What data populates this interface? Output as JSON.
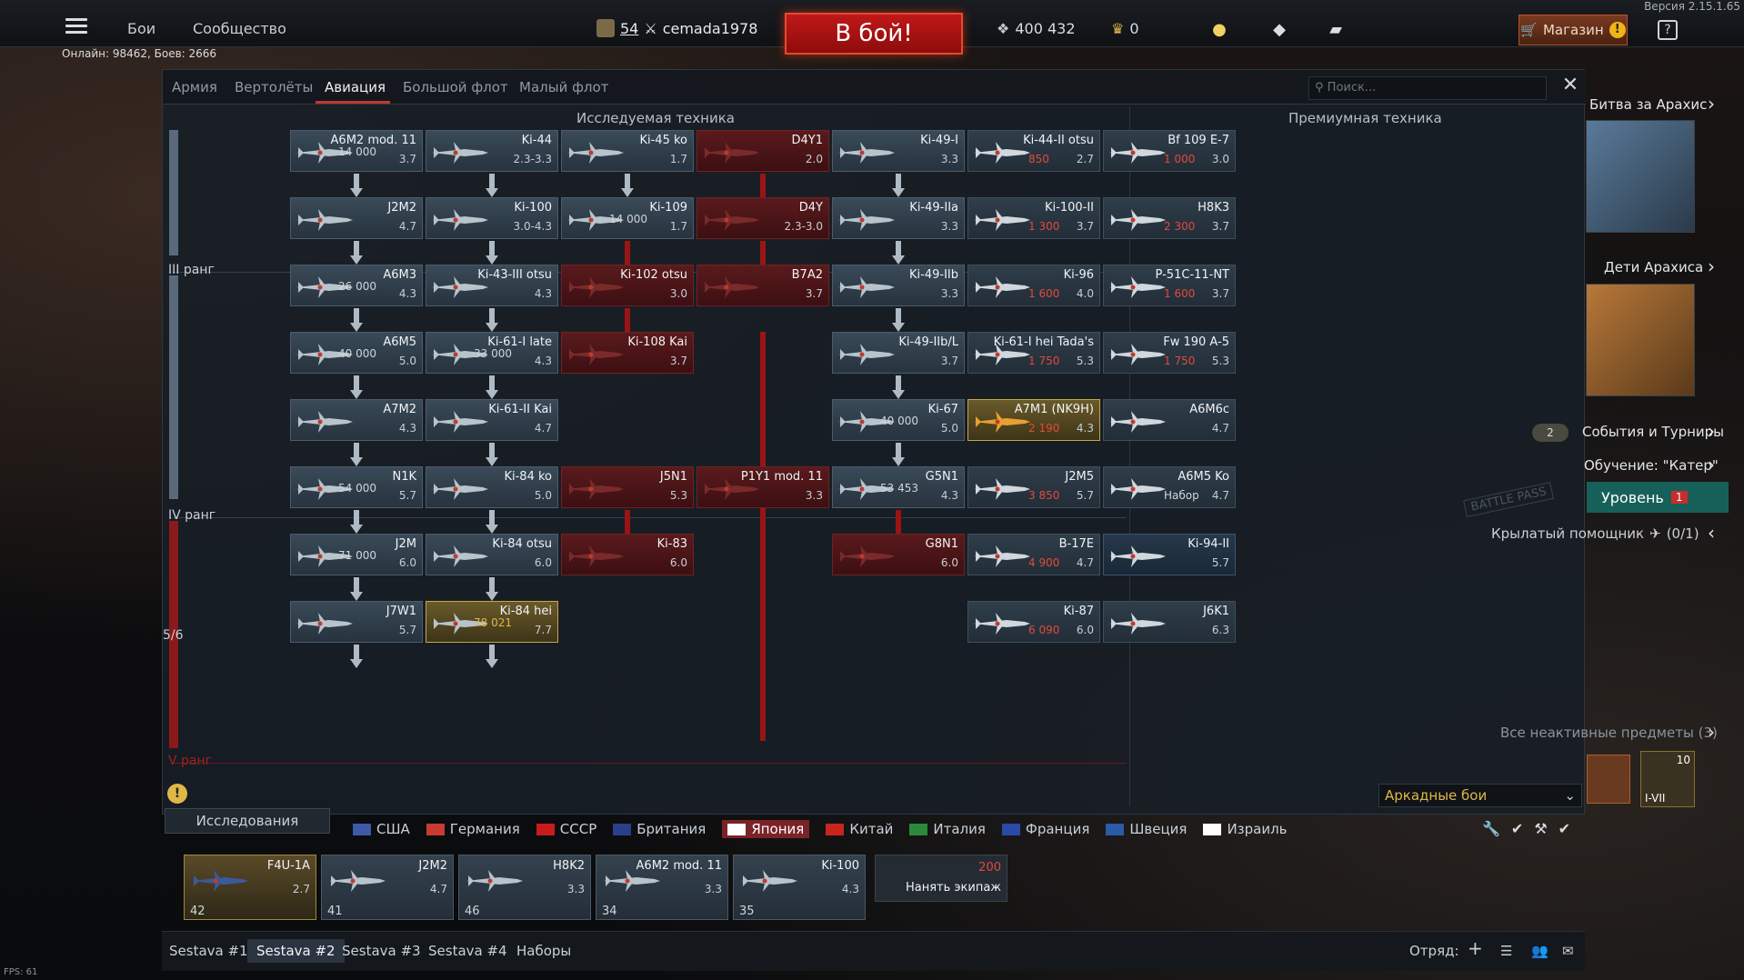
{
  "topbar": {
    "nav": [
      "Бои",
      "Сообщество"
    ],
    "online": "Онлайн: 98462, Боев: 2666",
    "version": "Версия 2.15.1.65",
    "player_level": "54",
    "player_name": "cemada1978",
    "to_battle": "В бой!",
    "silver": "400 432",
    "gold": "0",
    "shop": "Магазин"
  },
  "tabs": [
    "Армия",
    "Вертолёты",
    "Авиация",
    "Большой флот",
    "Малый флот"
  ],
  "active_tab": "Авиация",
  "search_placeholder": "Поиск...",
  "headers": {
    "research": "Исследуемая техника",
    "premium": "Премиумная техника"
  },
  "ranks": {
    "r3": "III ранг",
    "r4": "IV ранг",
    "r5": "V ранг",
    "progress": "5/6"
  },
  "cards": [
    {
      "n": "A6M2 mod. 11",
      "br": "3.7",
      "rp": "14 000",
      "s": "n",
      "c": 0,
      "r": 0
    },
    {
      "n": "Ki-44",
      "br": "2.3-3.3",
      "s": "n",
      "c": 1,
      "r": 0
    },
    {
      "n": "Ki-45 ko",
      "br": "1.7",
      "s": "n",
      "c": 2,
      "r": 0
    },
    {
      "n": "D4Y1",
      "br": "2.0",
      "s": "red",
      "c": 3,
      "r": 0
    },
    {
      "n": "Ki-49-I",
      "br": "3.3",
      "s": "n",
      "c": 4,
      "r": 0
    },
    {
      "n": "J2M2",
      "br": "4.7",
      "s": "n",
      "c": 0,
      "r": 1
    },
    {
      "n": "Ki-100",
      "br": "3.0-4.3",
      "s": "n",
      "c": 1,
      "r": 1
    },
    {
      "n": "Ki-109",
      "br": "1.7",
      "rp": "14 000",
      "s": "n",
      "c": 2,
      "r": 1
    },
    {
      "n": "D4Y",
      "br": "2.3-3.0",
      "s": "red",
      "c": 3,
      "r": 1
    },
    {
      "n": "Ki-49-IIa",
      "br": "3.3",
      "s": "n",
      "c": 4,
      "r": 1
    },
    {
      "n": "A6M3",
      "br": "4.3",
      "rp": "26 000",
      "s": "n",
      "c": 0,
      "r": 2
    },
    {
      "n": "Ki-43-III otsu",
      "br": "4.3",
      "s": "n",
      "c": 1,
      "r": 2
    },
    {
      "n": "Ki-102 otsu",
      "br": "3.0",
      "s": "red",
      "c": 2,
      "r": 2
    },
    {
      "n": "B7A2",
      "br": "3.7",
      "s": "red",
      "c": 3,
      "r": 2
    },
    {
      "n": "Ki-49-IIb",
      "br": "3.3",
      "s": "n",
      "c": 4,
      "r": 2
    },
    {
      "n": "A6M5",
      "br": "5.0",
      "rp": "40 000",
      "s": "n",
      "c": 0,
      "r": 3
    },
    {
      "n": "Ki-61-I late",
      "br": "4.3",
      "rp": "33 000",
      "s": "n",
      "c": 1,
      "r": 3
    },
    {
      "n": "Ki-108 Kai",
      "br": "3.7",
      "s": "red",
      "c": 2,
      "r": 3
    },
    {
      "n": "Ki-49-IIb/L",
      "br": "3.7",
      "s": "n",
      "c": 4,
      "r": 3
    },
    {
      "n": "A7M2",
      "br": "4.3",
      "s": "n",
      "c": 0,
      "r": 4
    },
    {
      "n": "Ki-61-II Kai",
      "br": "4.7",
      "s": "n",
      "c": 1,
      "r": 4
    },
    {
      "n": "Ki-67",
      "br": "5.0",
      "rp": "40 000",
      "s": "n",
      "c": 4,
      "r": 4
    },
    {
      "n": "N1K",
      "br": "5.7",
      "rp": "54 000",
      "s": "n",
      "c": 0,
      "r": 5
    },
    {
      "n": "Ki-84 ko",
      "br": "5.0",
      "s": "n",
      "c": 1,
      "r": 5
    },
    {
      "n": "J5N1",
      "br": "5.3",
      "s": "red",
      "c": 2,
      "r": 5
    },
    {
      "n": "P1Y1 mod. 11",
      "br": "3.3",
      "s": "red",
      "c": 3,
      "r": 5
    },
    {
      "n": "G5N1",
      "br": "4.3",
      "rp": "53 453",
      "s": "n",
      "c": 4,
      "r": 5
    },
    {
      "n": "J2M",
      "br": "6.0",
      "rp": "71 000",
      "s": "n",
      "c": 0,
      "r": 6
    },
    {
      "n": "Ki-84 otsu",
      "br": "6.0",
      "s": "n",
      "c": 1,
      "r": 6
    },
    {
      "n": "Ki-83",
      "br": "6.0",
      "s": "red",
      "c": 2,
      "r": 6
    },
    {
      "n": "G8N1",
      "br": "6.0",
      "s": "red",
      "c": 4,
      "r": 6
    },
    {
      "n": "J7W1",
      "br": "5.7",
      "s": "n",
      "c": 0,
      "r": 7
    },
    {
      "n": "Ki-84 hei",
      "br": "7.7",
      "rp": "78 021",
      "s": "gold",
      "c": 1,
      "r": 7
    }
  ],
  "premium": [
    {
      "n": "Ki-44-II otsu",
      "br": "2.7",
      "price": "850",
      "c": 0,
      "r": 0
    },
    {
      "n": "Bf 109 E-7",
      "br": "3.0",
      "price": "1 000",
      "c": 1,
      "r": 0
    },
    {
      "n": "Ki-100-II",
      "br": "3.7",
      "price": "1 300",
      "c": 0,
      "r": 1
    },
    {
      "n": "H8K3",
      "br": "3.7",
      "price": "2 300",
      "c": 1,
      "r": 1
    },
    {
      "n": "Ki-96",
      "br": "4.0",
      "price": "1 600",
      "c": 0,
      "r": 2
    },
    {
      "n": "P-51C-11-NT",
      "br": "3.7",
      "price": "1 600",
      "c": 1,
      "r": 2
    },
    {
      "n": "Ki-61-I hei Tada's",
      "br": "5.3",
      "price": "1 750",
      "c": 0,
      "r": 3
    },
    {
      "n": "Fw 190 A-5",
      "br": "5.3",
      "price": "1 750",
      "c": 1,
      "r": 3
    },
    {
      "n": "A7M1 (NK9H)",
      "br": "4.3",
      "price": "2 190",
      "c": 0,
      "r": 4,
      "s": "orange"
    },
    {
      "n": "A6M6c",
      "br": "4.7",
      "c": 1,
      "r": 4
    },
    {
      "n": "J2M5",
      "br": "5.7",
      "price": "3 850",
      "c": 0,
      "r": 5
    },
    {
      "n": "A6M5 Ko",
      "br": "4.7",
      "extra": "Набор",
      "c": 1,
      "r": 5
    },
    {
      "n": "B-17E",
      "br": "4.7",
      "price": "4 900",
      "c": 0,
      "r": 6
    },
    {
      "n": "Ki-94-II",
      "br": "5.7",
      "c": 1,
      "r": 6,
      "s": "blue"
    },
    {
      "n": "Ki-87",
      "br": "6.0",
      "price": "6 090",
      "c": 0,
      "r": 7
    },
    {
      "n": "J6K1",
      "br": "6.3",
      "c": 1,
      "r": 7
    }
  ],
  "side": {
    "event1": "Битва за Арахис",
    "event2": "Дети Арахиса",
    "events": "События и Турниры",
    "events_count": "2",
    "training": "Обучение: \"Катер\"",
    "level": "Уровень",
    "level_badge": "1",
    "battlepass": "BATTLE PASS",
    "helper": "Крылатый помощник",
    "helper_count": "(0/1)",
    "inactive": "Все неактивные предметы (3)",
    "item_count": "10",
    "item_label": "I-VII"
  },
  "bottom": {
    "research": "Исследования",
    "mode": "Аркадные бои",
    "hire": "Нанять экипаж",
    "hire_price": "200",
    "squad": "Отряд:",
    "fps": "FPS: 61"
  },
  "nations": [
    {
      "n": "США",
      "c": "#3c5aa8"
    },
    {
      "n": "Германия",
      "c": "#c83a32"
    },
    {
      "n": "СССР",
      "c": "#c81c1c"
    },
    {
      "n": "Британия",
      "c": "#2a3f8a"
    },
    {
      "n": "Япония",
      "c": "#ffffff",
      "active": true
    },
    {
      "n": "Китай",
      "c": "#c8261c"
    },
    {
      "n": "Италия",
      "c": "#2a8a3a"
    },
    {
      "n": "Франция",
      "c": "#2a4aa8"
    },
    {
      "n": "Швеция",
      "c": "#2a5aa8"
    },
    {
      "n": "Израиль",
      "c": "#ffffff"
    }
  ],
  "crew": [
    {
      "n": "F4U-1A",
      "br": "2.7",
      "num": "42",
      "sel": true
    },
    {
      "n": "J2M2",
      "br": "4.7",
      "num": "41"
    },
    {
      "n": "H8K2",
      "br": "3.3",
      "num": "46"
    },
    {
      "n": "A6M2 mod. 11",
      "br": "3.3",
      "num": "34"
    },
    {
      "n": "Ki-100",
      "br": "4.3",
      "num": "35"
    }
  ],
  "presets": [
    "Sestava #1",
    "Sestava #2",
    "Sestava #3",
    "Sestava #4",
    "Наборы"
  ],
  "active_preset": "Sestava #2",
  "colors": {
    "accent_red": "#c03830",
    "gold": "#e0b848",
    "teal": "#17605a"
  }
}
